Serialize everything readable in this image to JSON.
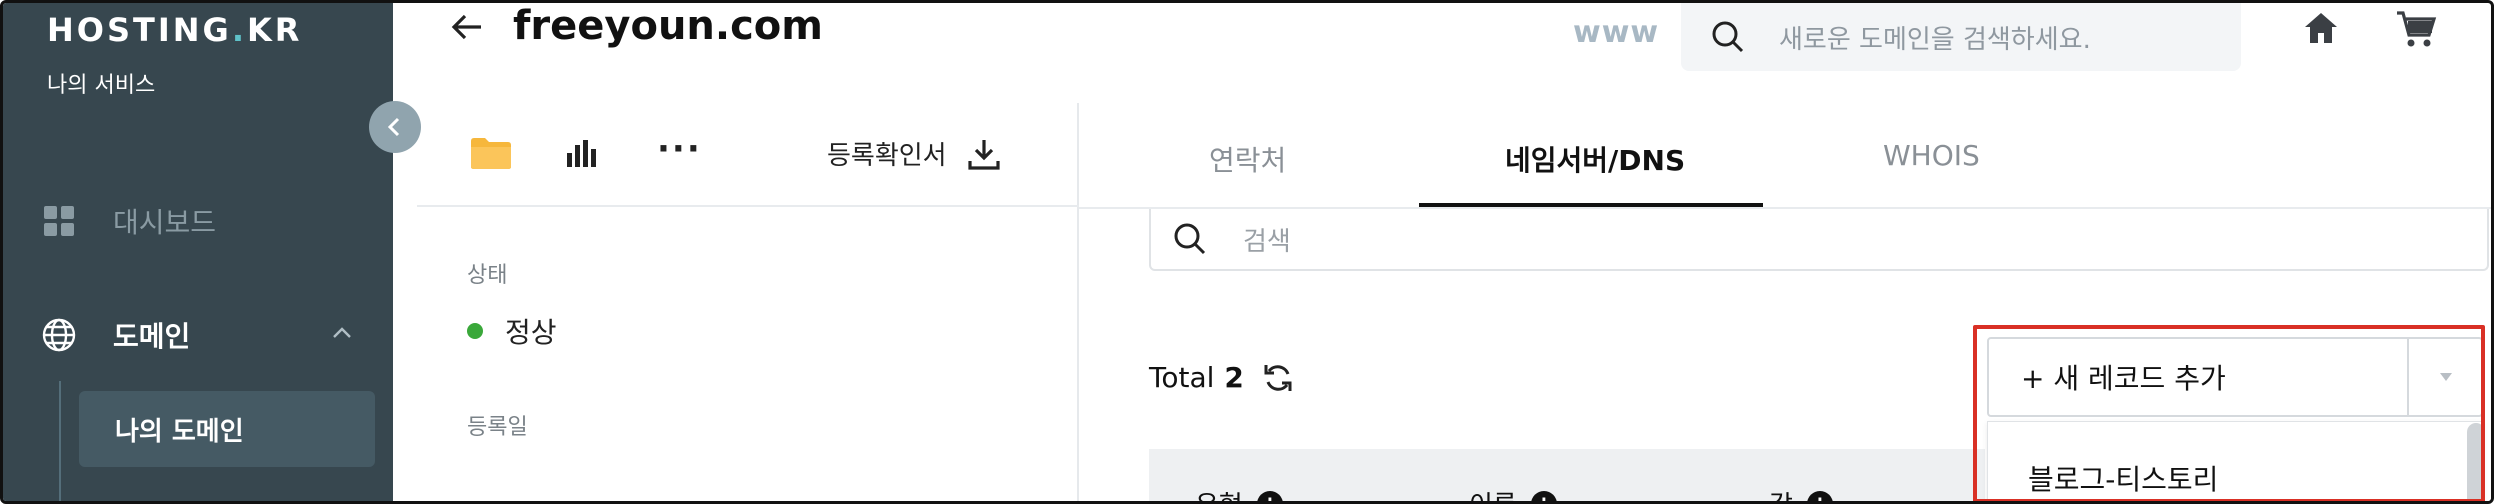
{
  "sidebar": {
    "logo_main": "HOSTING",
    "logo_dot": ".",
    "logo_suffix": "KR",
    "service_label": "나의 서비스",
    "items": [
      {
        "label": "대시보드",
        "icon": "dashboard-icon"
      },
      {
        "label": "도메인",
        "icon": "globe-icon",
        "expanded": true
      }
    ],
    "sub_items": [
      {
        "label": "나의 도메인",
        "active": true
      }
    ]
  },
  "header": {
    "domain_title": "freeyoun.com",
    "www_label": "www",
    "search_placeholder": "새로운 도메인을 검색하세요."
  },
  "left_panel": {
    "toolbar": {
      "cert_label": "등록확인서"
    },
    "status_label": "상태",
    "status_value": "정상",
    "status_color": "#3aa83a",
    "registered_label": "등록일"
  },
  "right_panel": {
    "tabs": [
      {
        "label": "연락처",
        "active": false
      },
      {
        "label": "네임서버/DNS",
        "active": true
      },
      {
        "label": "WHOIS",
        "active": false
      }
    ],
    "search_placeholder": "검색",
    "total_label": "Total",
    "total_count": "2",
    "add_record_label": "+ 새 레코드 추가",
    "dropdown_items": [
      "블로그-티스토리"
    ],
    "table_headers": [
      "유형",
      "이름",
      "값"
    ]
  },
  "colors": {
    "sidebar_bg": "#37474f",
    "highlight_border": "#d93025",
    "accent": "#5fc2c9"
  }
}
